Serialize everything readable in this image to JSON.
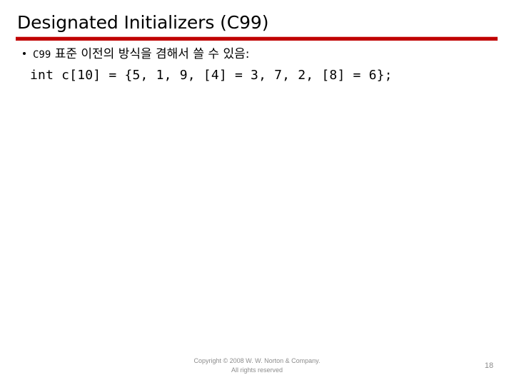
{
  "slide": {
    "title": "Designated Initializers (C99)",
    "accent_color": "#C00000",
    "background_color": "#FFFFFF",
    "text_color": "#000000",
    "footer_color": "#8C8C8C"
  },
  "body": {
    "bullet_marker": "•",
    "bullet_prefix_code": "C99",
    "bullet_text": " 표준 이전의 방식을 겸해서 쓸 수 있음:",
    "code_line": "int c[10] = {5, 1, 9, [4] = 3, 7, 2, [8] = 6};"
  },
  "footer": {
    "copyright_line1": "Copyright © 2008 W. W. Norton & Company.",
    "copyright_line2": "All rights reserved",
    "page_number": "18"
  }
}
